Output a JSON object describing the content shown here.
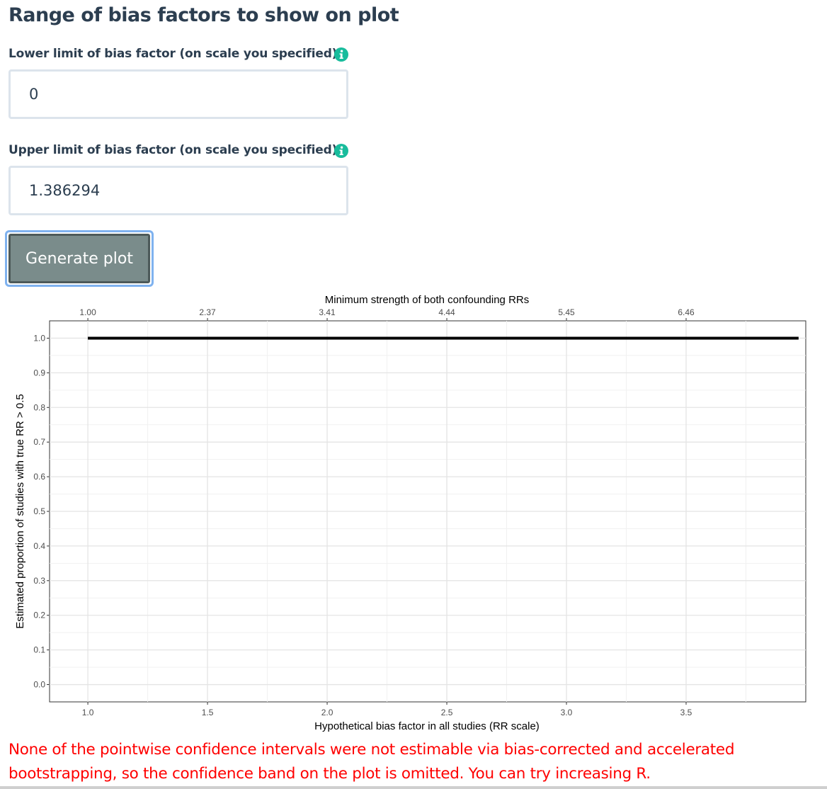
{
  "section": {
    "title": "Range of bias factors to show on plot"
  },
  "lower": {
    "label": "Lower limit of bias factor (on scale you specified)",
    "value": "0"
  },
  "upper": {
    "label": "Upper limit of bias factor (on scale you specified)",
    "value": "1.386294"
  },
  "button": {
    "label": "Generate plot"
  },
  "colors": {
    "info": "#18bc9c",
    "text": "#2c3e50",
    "button_bg": "#7a8c8b",
    "warning": "#ff0000"
  },
  "icons": {
    "info": "info-circle-icon"
  },
  "chart_data": {
    "type": "line",
    "title": "",
    "top_axis_label": "Minimum strength of both confounding RRs",
    "top_ticks": [
      {
        "at": 1.0,
        "label": "1.00"
      },
      {
        "at": 1.5,
        "label": "2.37"
      },
      {
        "at": 2.0,
        "label": "3.41"
      },
      {
        "at": 2.5,
        "label": "4.44"
      },
      {
        "at": 3.0,
        "label": "5.45"
      },
      {
        "at": 3.5,
        "label": "6.46"
      }
    ],
    "xlabel": "Hypothetical bias factor in all studies (RR scale)",
    "ylabel": "Estimated proportion of studies with true RR > 0.5",
    "x_ticks": [
      "1.0",
      "1.5",
      "2.0",
      "2.5",
      "3.0",
      "3.5"
    ],
    "y_ticks": [
      "0.0",
      "0.1",
      "0.2",
      "0.3",
      "0.4",
      "0.5",
      "0.6",
      "0.7",
      "0.8",
      "0.9",
      "1.0"
    ],
    "xlim": [
      0.84,
      4.0
    ],
    "ylim": [
      -0.05,
      1.05
    ],
    "grid": true,
    "series": [
      {
        "x": [
          1.0,
          3.97
        ],
        "y": [
          1.0,
          1.0
        ],
        "color": "#000000"
      }
    ]
  },
  "warning": {
    "text": "None of the pointwise confidence intervals were not estimable via bias-corrected and accelerated bootstrapping, so the confidence band on the plot is omitted. You can try increasing R."
  }
}
